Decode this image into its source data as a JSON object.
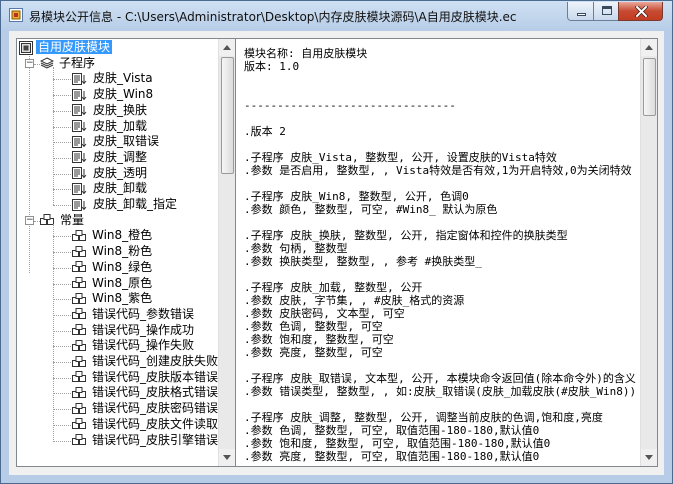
{
  "window": {
    "title": "易模块公开信息 - C:\\Users\\Administrator\\Desktop\\内存皮肤模块源码\\A自用皮肤模块.ec"
  },
  "tree": {
    "root": "自用皮肤模块",
    "groups": [
      {
        "label": "子程序",
        "icon": "stack-icon",
        "items": [
          "皮肤_Vista",
          "皮肤_Win8",
          "皮肤_换肤",
          "皮肤_加载",
          "皮肤_取错误",
          "皮肤_调整",
          "皮肤_透明",
          "皮肤_卸载",
          "皮肤_卸载_指定"
        ]
      },
      {
        "label": "常量",
        "icon": "cubes-icon",
        "items": [
          "Win8_橙色",
          "Win8_粉色",
          "Win8_绿色",
          "Win8_原色",
          "Win8_紫色",
          "错误代码_参数错误",
          "错误代码_操作成功",
          "错误代码_操作失败",
          "错误代码_创建皮肤失败",
          "错误代码_皮肤版本错误",
          "错误代码_皮肤格式错误",
          "错误代码_皮肤密码错误",
          "错误代码_皮肤文件读取失败",
          "错误代码_皮肤引擎错误"
        ]
      }
    ]
  },
  "code": {
    "lines": [
      "模块名称: 自用皮肤模块",
      "版本: 1.0",
      "",
      "",
      "--------------------------------",
      "",
      ".版本 2",
      "",
      ".子程序 皮肤_Vista, 整数型, 公开, 设置皮肤的Vista特效",
      ".参数 是否启用, 整数型, , Vista特效是否有效,1为开启特效,0为关闭特效",
      "",
      ".子程序 皮肤_Win8, 整数型, 公开, 色调0",
      ".参数 颜色, 整数型, 可空, #Win8_ 默认为原色",
      "",
      ".子程序 皮肤_换肤, 整数型, 公开, 指定窗体和控件的换肤类型",
      ".参数 句柄, 整数型",
      ".参数 换肤类型, 整数型, , 参考 #换肤类型_",
      "",
      ".子程序 皮肤_加载, 整数型, 公开",
      ".参数 皮肤, 字节集, , #皮肤_格式的资源",
      ".参数 皮肤密码, 文本型, 可空",
      ".参数 色调, 整数型, 可空",
      ".参数 饱和度, 整数型, 可空",
      ".参数 亮度, 整数型, 可空",
      "",
      ".子程序 皮肤_取错误, 文本型, 公开, 本模块命令返回值(除本命令外)的含义",
      ".参数 错误类型, 整数型, , 如:皮肤_取错误(皮肤_加载皮肤(#皮肤_Win8))",
      "",
      ".子程序 皮肤_调整, 整数型, 公开, 调整当前皮肤的色调,饱和度,亮度",
      ".参数 色调, 整数型, 可空, 取值范围-180-180,默认值0",
      ".参数 饱和度, 整数型, 可空, 取值范围-180-180,默认值0",
      ".参数 亮度, 整数型, 可空, 取值范围-180-180,默认值0",
      "",
      ""
    ]
  }
}
